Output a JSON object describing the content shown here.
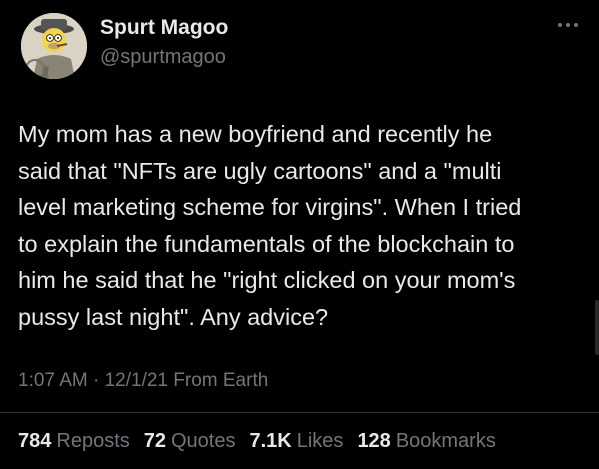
{
  "author": {
    "display_name": "Spurt Magoo",
    "handle": "@spurtmagoo",
    "avatar_icon": "cartoon-avatar-icon"
  },
  "tweet": {
    "text": "My mom has a new boyfriend and recently he\nsaid that \"NFTs are ugly cartoons\" and a \"multi\nlevel marketing scheme for virgins\". When I tried\nto explain the fundamentals of the blockchain to\nhim he said that he \"right clicked on your mom's\npussy last night\". Any advice?",
    "meta": "1:07 AM · 12/1/21 From Earth"
  },
  "stats": [
    {
      "number": "784",
      "label": "Reposts"
    },
    {
      "number": "72",
      "label": "Quotes"
    },
    {
      "number": "7.1K",
      "label": "Likes"
    },
    {
      "number": "128",
      "label": "Bookmarks"
    }
  ],
  "icons": {
    "more": "more-options-icon"
  },
  "colors": {
    "background": "#000000",
    "primary_text": "#e7e9ea",
    "secondary_text": "#71767b",
    "divider": "#2f3336"
  }
}
